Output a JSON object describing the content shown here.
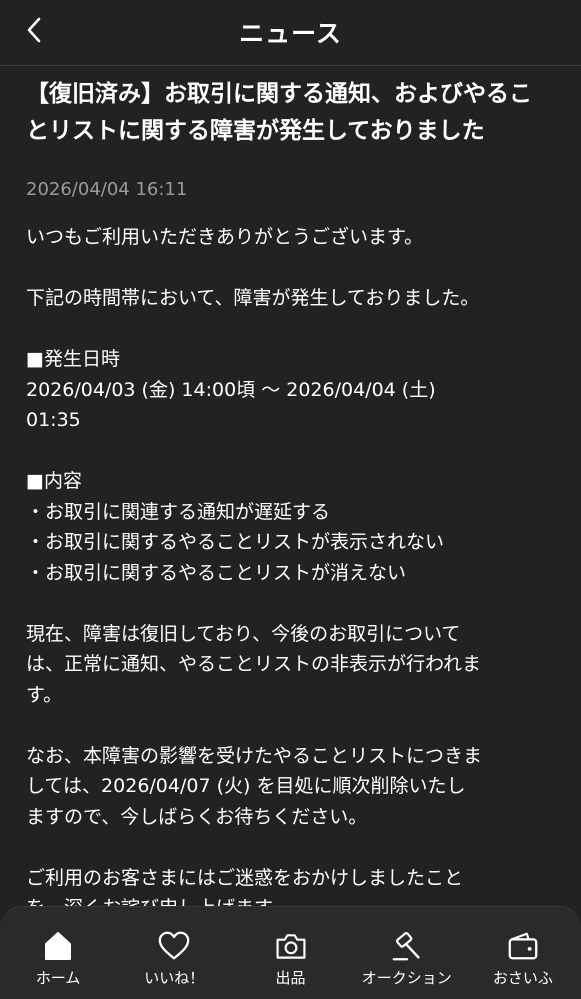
{
  "header": {
    "title": "ニュース"
  },
  "article": {
    "title_lines": [
      "【復旧済み】お取引に関する通知、およびやるこ",
      "とリストに関する障害が発生しておりました"
    ],
    "date": "2026/04/04 16:11",
    "paragraphs": [
      [
        "いつもご利用いただきありがとうございます。"
      ],
      [
        "下記の時間帯において、障害が発生しておりました。"
      ],
      [
        "■発生日時",
        "2026/04/03 (金) 14:00頃 〜 2026/04/04 (土)",
        "01:35"
      ],
      [
        "■内容",
        "・お取引に関連する通知が遅延する",
        "・お取引に関するやることリストが表示されない",
        "・お取引に関するやることリストが消えない"
      ],
      [
        "現在、障害は復旧しており、今後のお取引について",
        "は、正常に通知、やることリストの非表示が行われま",
        "す。"
      ],
      [
        "なお、本障害の影響を受けたやることリストにつきま",
        "しては、2026/04/07 (火) を目処に順次削除いたし",
        "ますので、今しばらくお待ちください。"
      ],
      [
        "ご利用のお客さまにはご迷惑をおかけしましたこと",
        "を、深くお詫び申し上げます。"
      ]
    ]
  },
  "tabbar": {
    "items": [
      {
        "label": "ホーム",
        "icon": "home-icon"
      },
      {
        "label": "いいね！",
        "icon": "heart-icon"
      },
      {
        "label": "出品",
        "icon": "camera-icon"
      },
      {
        "label": "オークション",
        "icon": "gavel-icon"
      },
      {
        "label": "おさいふ",
        "icon": "wallet-icon"
      }
    ]
  }
}
